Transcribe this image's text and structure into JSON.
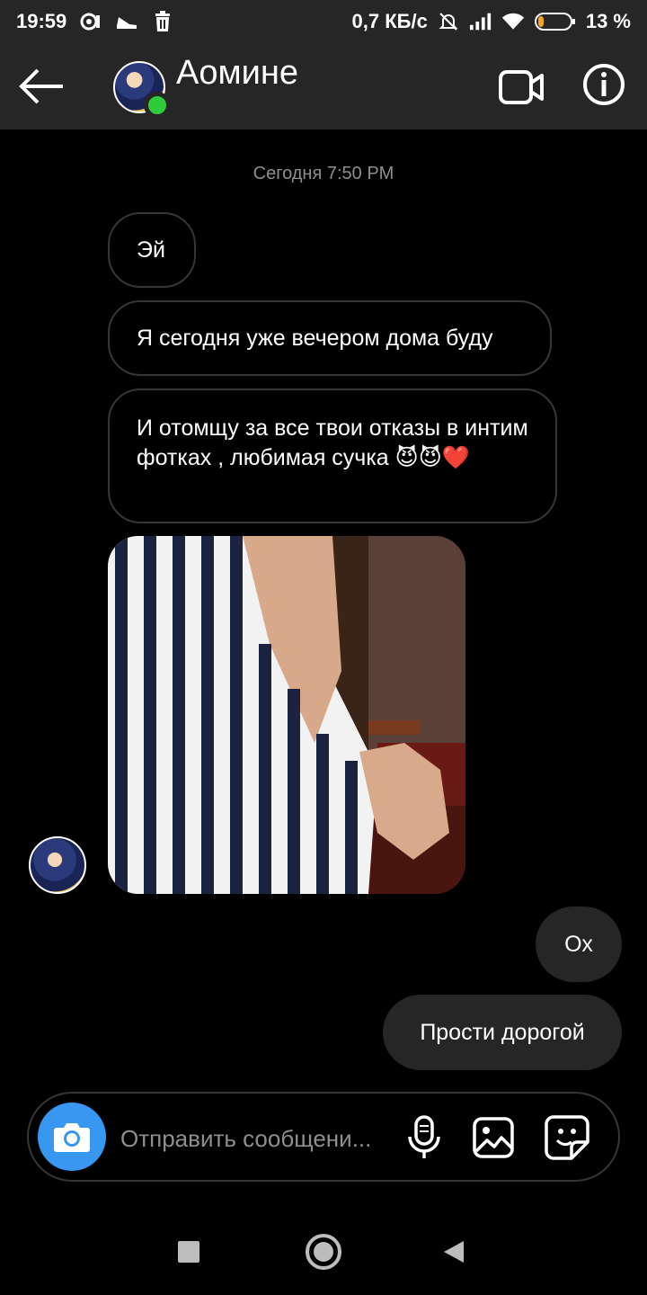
{
  "status_bar": {
    "time": "19:59",
    "network_speed": "0,7 КБ/с",
    "battery": "13 %"
  },
  "header": {
    "contact_name": "Аомине",
    "online": true
  },
  "chat": {
    "timestamp": "Сегодня 7:50 PM",
    "incoming": [
      {
        "text": "Эй"
      },
      {
        "text": "Я сегодня уже вечером дома буду"
      },
      {
        "text": "И отомщу за все твои отказы в интим фотках , любимая сучка 😈😈❤️"
      }
    ],
    "outgoing": [
      {
        "text": "Ох"
      },
      {
        "text": "Прости дорогой"
      }
    ]
  },
  "composer": {
    "placeholder": "Отправить сообщени..."
  },
  "colors": {
    "header_bg": "#262626",
    "outgoing_bubble": "#262626",
    "camera_button": "#3897f0",
    "online_dot": "#2ecc3a"
  }
}
